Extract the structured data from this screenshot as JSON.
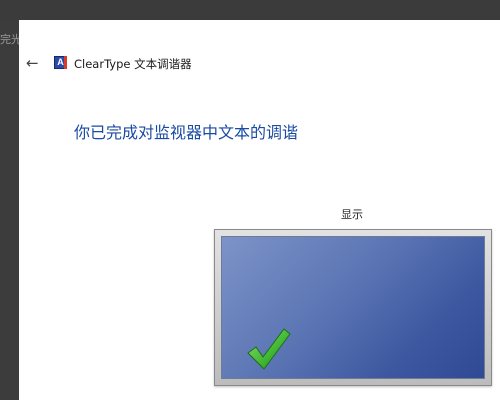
{
  "background": {
    "partial_text": "完光"
  },
  "window": {
    "title": "ClearType 文本调谐器",
    "app_icon_letter": "A",
    "heading": "你已完成对监视器中文本的调谐",
    "display_label": "显示"
  },
  "colors": {
    "heading": "#1b4aa3",
    "screen": "#4a63a8",
    "check": "#4cc23a"
  },
  "icons": {
    "back": "back-arrow-icon",
    "app": "cleartype-icon",
    "check": "checkmark-icon"
  }
}
